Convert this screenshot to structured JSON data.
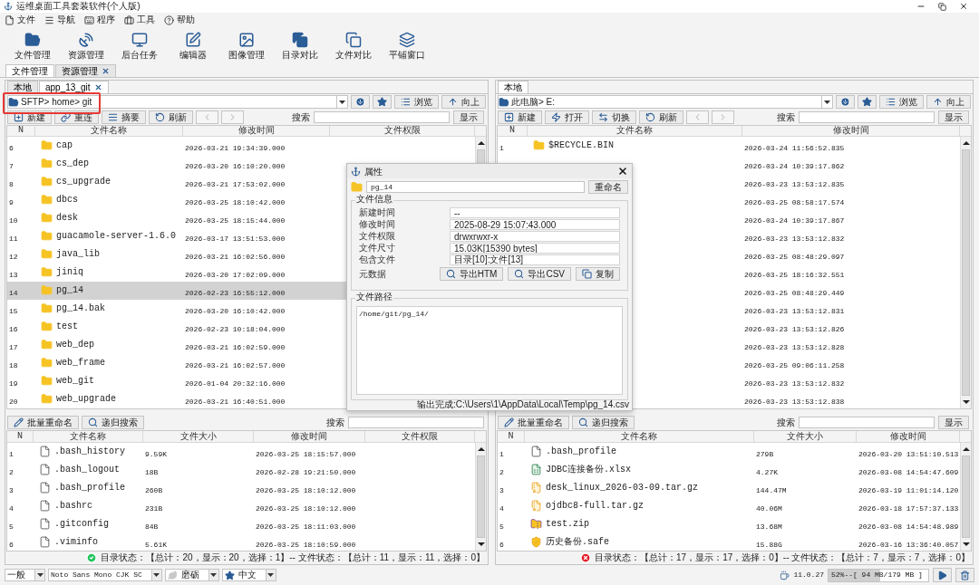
{
  "window": {
    "title": "运维桌面工具套装软件(个人版)"
  },
  "menu": [
    {
      "label": "文件",
      "kind": "file"
    },
    {
      "label": "导航",
      "kind": "nav"
    },
    {
      "label": "程序",
      "kind": "program"
    },
    {
      "label": "工具",
      "kind": "tools"
    },
    {
      "label": "帮助",
      "kind": "help"
    }
  ],
  "toolbar": [
    "文件管理",
    "资源管理",
    "后台任务",
    "编辑器",
    "图像管理",
    "目录对比",
    "文件对比",
    "平铺窗口"
  ],
  "main_tabs": [
    {
      "label": "文件管理",
      "selected": true,
      "closable": false
    },
    {
      "label": "资源管理",
      "selected": false,
      "closable": true
    }
  ],
  "panes": [
    {
      "tabs": [
        {
          "label": "本地",
          "selected": false,
          "closable": false
        },
        {
          "label": "app_13_git",
          "selected": true,
          "closable": true
        }
      ],
      "path": "SFTP> home> git",
      "highlighted": true,
      "path_buttons": [
        "浏览",
        "向上"
      ],
      "actions": [
        {
          "label": "新建",
          "kind": "new"
        },
        {
          "label": "重连",
          "kind": "reconnect"
        },
        {
          "label": "摘要",
          "kind": "summary"
        },
        {
          "label": "刷新",
          "kind": "refresh"
        }
      ],
      "back_enabled": false,
      "forward_enabled": false,
      "search_label": "搜索",
      "search_button": "显示",
      "dirs": {
        "columns": [
          "N",
          "文件名称",
          "修改时间",
          "文件权限"
        ],
        "rows": [
          {
            "n": "6",
            "name": "cap",
            "kind": "folder",
            "values": [
              "2026-03-21 19:34:39.000"
            ],
            "selected": false
          },
          {
            "n": "7",
            "name": "cs_dep",
            "kind": "folder",
            "values": [
              "2026-03-20 16:10:20.000"
            ],
            "selected": false
          },
          {
            "n": "8",
            "name": "cs_upgrade",
            "kind": "folder",
            "values": [
              "2026-03-21 17:53:02.000"
            ],
            "selected": false
          },
          {
            "n": "9",
            "name": "dbcs",
            "kind": "folder",
            "values": [
              "2026-03-25 18:10:42.000"
            ],
            "selected": false
          },
          {
            "n": "10",
            "name": "desk",
            "kind": "folder",
            "values": [
              "2026-03-25 18:15:44.000"
            ],
            "selected": false
          },
          {
            "n": "11",
            "name": "guacamole-server-1.6.0",
            "kind": "folder",
            "values": [
              "2026-03-17 13:51:53.000"
            ],
            "selected": false
          },
          {
            "n": "12",
            "name": "java_lib",
            "kind": "folder",
            "values": [
              "2026-03-21 16:02:56.000"
            ],
            "selected": false
          },
          {
            "n": "13",
            "name": "jiniq",
            "kind": "folder",
            "values": [
              "2026-03-20 17:02:09.000"
            ],
            "selected": false
          },
          {
            "n": "14",
            "name": "pg_14",
            "kind": "folder",
            "values": [
              "2026-02-23 16:55:12.000"
            ],
            "selected": true
          },
          {
            "n": "15",
            "name": "pg_14.bak",
            "kind": "folder",
            "values": [
              "2026-03-20 16:10:42.000"
            ],
            "selected": false
          },
          {
            "n": "16",
            "name": "test",
            "kind": "folder",
            "values": [
              "2026-02-23 10:18:04.000"
            ],
            "selected": false
          },
          {
            "n": "17",
            "name": "web_dep",
            "kind": "folder",
            "values": [
              "2026-03-21 16:02:59.000"
            ],
            "selected": false
          },
          {
            "n": "18",
            "name": "web_frame",
            "kind": "folder",
            "values": [
              "2026-03-21 16:02:57.000"
            ],
            "selected": false
          },
          {
            "n": "19",
            "name": "web_git",
            "kind": "folder",
            "values": [
              "2026-01-04 20:32:16.000"
            ],
            "selected": false
          },
          {
            "n": "20",
            "name": "web_upgrade",
            "kind": "folder",
            "values": [
              "2026-03-21 16:40:51.000"
            ],
            "selected": false
          }
        ]
      },
      "file_actions": [
        {
          "label": "批量重命名",
          "kind": "rename"
        },
        {
          "label": "递归搜索",
          "kind": "search"
        }
      ],
      "file_search_label": "搜索",
      "files": {
        "columns": [
          "N",
          "文件名称",
          "文件大小",
          "修改时间",
          "文件权限"
        ],
        "rows": [
          {
            "n": "1",
            "name": ".bash_history",
            "kind": "file",
            "values": [
              "9.59K",
              "2026-03-25 18:15:57.000"
            ]
          },
          {
            "n": "2",
            "name": ".bash_logout",
            "kind": "file",
            "values": [
              "18B",
              "2026-02-28 19:21:50.000"
            ]
          },
          {
            "n": "3",
            "name": ".bash_profile",
            "kind": "file",
            "values": [
              "260B",
              "2026-03-25 18:10:12.000"
            ]
          },
          {
            "n": "4",
            "name": ".bashrc",
            "kind": "file",
            "values": [
              "231B",
              "2026-03-25 18:10:12.000"
            ]
          },
          {
            "n": "5",
            "name": ".gitconfig",
            "kind": "file",
            "values": [
              "84B",
              "2026-03-25 18:11:03.000"
            ]
          },
          {
            "n": "6",
            "name": ".viminfo",
            "kind": "file",
            "values": [
              "5.61K",
              "2026-03-25 18:10:59.000"
            ]
          }
        ]
      },
      "status": {
        "ok": true,
        "text": "目录状态：【总计：20，显示：20，选择：1】-- 文件状态：【总计：11，显示：11，选择：0】"
      }
    },
    {
      "tabs": [
        {
          "label": "本地",
          "selected": true,
          "closable": false
        }
      ],
      "path": "此电脑> E:",
      "highlighted": false,
      "path_buttons": [
        "浏览",
        "向上"
      ],
      "actions": [
        {
          "label": "新建",
          "kind": "new"
        },
        {
          "label": "打开",
          "kind": "open"
        },
        {
          "label": "切换",
          "kind": "switch"
        },
        {
          "label": "刷新",
          "kind": "refresh"
        }
      ],
      "back_enabled": false,
      "forward_enabled": false,
      "search_label": "搜索",
      "search_button": "显示",
      "dirs": {
        "columns": [
          "N",
          "文件名称",
          "修改时间"
        ],
        "rows": [
          {
            "n": "1",
            "name": "$RECYCLE.BIN",
            "kind": "folder",
            "values": [
              "2026-03-24 11:56:52.835"
            ],
            "selected": false
          },
          {
            "values": [
              "2026-03-24 10:39:17.862"
            ],
            "selected": false
          },
          {
            "values": [
              "2026-03-23 13:53:12.835"
            ],
            "selected": false
          },
          {
            "values": [
              "2026-03-25 08:58:17.574"
            ],
            "selected": false
          },
          {
            "values": [
              "2026-03-24 10:39:17.867"
            ],
            "selected": false
          },
          {
            "values": [
              "2026-03-23 13:53:12.832"
            ],
            "selected": false
          },
          {
            "values": [
              "2026-03-25 08:48:29.097"
            ],
            "selected": false
          },
          {
            "values": [
              "2026-03-25 18:16:32.551"
            ],
            "selected": false
          },
          {
            "values": [
              "2026-03-25 08:48:29.449"
            ],
            "selected": false
          },
          {
            "values": [
              "2026-03-23 13:53:12.831"
            ],
            "selected": false
          },
          {
            "values": [
              "2026-03-23 13:53:12.826"
            ],
            "selected": false
          },
          {
            "values": [
              "2026-03-23 13:53:12.828"
            ],
            "selected": false
          },
          {
            "values": [
              "2026-03-25 09:06:11.258"
            ],
            "selected": false
          },
          {
            "values": [
              "2026-03-23 13:53:12.832"
            ],
            "selected": false
          },
          {
            "values": [
              "2026-03-23 13:53:12.838"
            ],
            "selected": false
          }
        ]
      },
      "file_actions": [
        {
          "label": "批量重命名",
          "kind": "rename"
        },
        {
          "label": "递归搜索",
          "kind": "search"
        }
      ],
      "file_search_label": "搜索",
      "file_search_button": "显示",
      "files": {
        "columns": [
          "N",
          "文件名称",
          "文件大小",
          "修改时间"
        ],
        "rows": [
          {
            "n": "1",
            "name": ".bash_profile",
            "kind": "file",
            "values": [
              "279B",
              "2026-03-20 13:51:10.513"
            ]
          },
          {
            "n": "2",
            "name": "JDBC连接备份.xlsx",
            "kind": "excel",
            "values": [
              "4.27K",
              "2026-03-08 14:54:47.609"
            ]
          },
          {
            "n": "3",
            "name": "desk_linux_2026-03-09.tar.gz",
            "kind": "archive",
            "values": [
              "144.47M",
              "2026-03-19 11:01:14.120"
            ]
          },
          {
            "n": "4",
            "name": "ojdbc8-full.tar.gz",
            "kind": "archive",
            "values": [
              "40.06M",
              "2026-03-18 17:57:37.133"
            ]
          },
          {
            "n": "5",
            "name": "test.zip",
            "kind": "zip",
            "values": [
              "13.68M",
              "2026-03-08 14:54:48.989"
            ]
          },
          {
            "n": "6",
            "name": "历史备份.safe",
            "kind": "safe",
            "values": [
              "15.88G",
              "2026-03-16 13:36:40.057"
            ]
          }
        ]
      },
      "status": {
        "ok": false,
        "text": "目录状态：【总计：17，显示：17，选择：0】-- 文件状态：【总计：7，显示：7，选择：0】"
      }
    }
  ],
  "dialog": {
    "title": "属性",
    "name": "pg_14",
    "rename": "重命名",
    "info_title": "文件信息",
    "fields": [
      {
        "label": "新建时间",
        "value": "--"
      },
      {
        "label": "修改时间",
        "value": "2025-08-29 15:07:43.000"
      },
      {
        "label": "文件权限",
        "value": "drwxrwxr-x"
      },
      {
        "label": "文件尺寸",
        "value": "15.03K[15390 bytes]"
      },
      {
        "label": "包含文件",
        "value": "目录[10]:文件[13]"
      }
    ],
    "meta_label": "元数据",
    "meta_buttons": [
      {
        "label": "导出HTM",
        "kind": "search"
      },
      {
        "label": "导出CSV",
        "kind": "search"
      },
      {
        "label": "复制",
        "kind": "copy"
      }
    ],
    "path_title": "文件路径",
    "path": "/home/git/pg_14/",
    "message": "输出完成:C:\\Users\\1\\AppData\\Local\\Temp\\pg_14.csv"
  },
  "bottom_bar": {
    "selects": [
      {
        "value": "一般",
        "kind": "plain"
      },
      {
        "value": "Noto Sans Mono CJK SC",
        "kind": "plain"
      },
      {
        "value": "磨砺",
        "kind": "leaf"
      },
      {
        "value": "中文",
        "kind": "star"
      }
    ],
    "version": "11.0.27",
    "memory": {
      "text": "52%--[ 94 MB/179 MB ]",
      "level": 0.52
    }
  }
}
